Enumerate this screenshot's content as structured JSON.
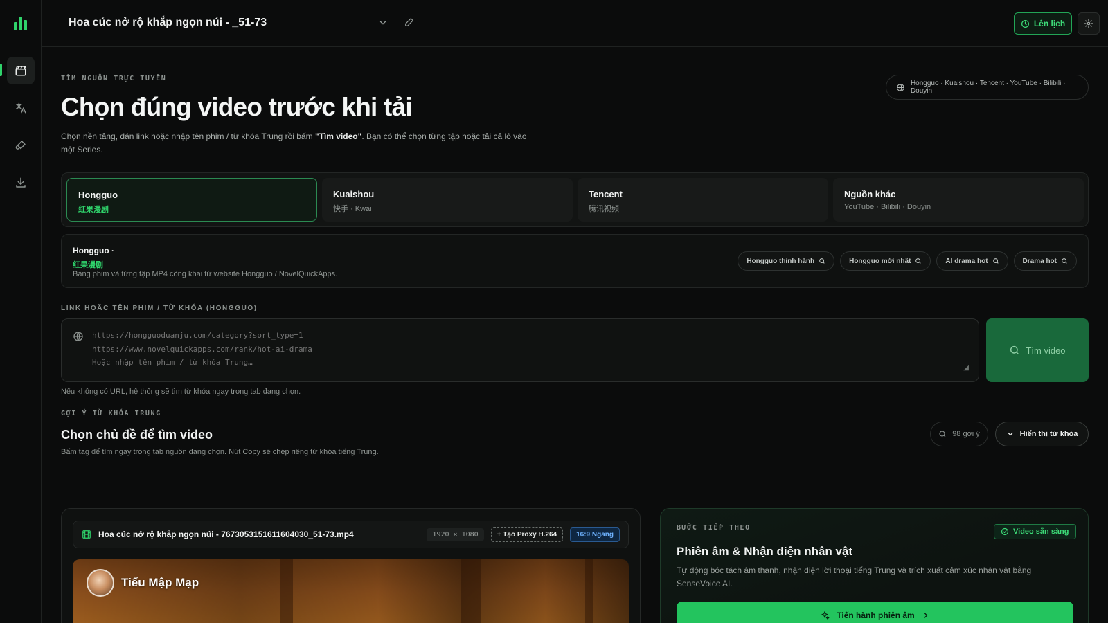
{
  "app": {
    "accent": "#2fd36b"
  },
  "sidebar": {
    "items": [
      {
        "icon": "clapperboard-icon",
        "active": true
      },
      {
        "icon": "translate-icon",
        "active": false
      },
      {
        "icon": "brush-icon",
        "active": false
      },
      {
        "icon": "download-icon",
        "active": false
      }
    ]
  },
  "header": {
    "project_title": "Hoa cúc nở rộ khắp ngọn núi - _51-73",
    "schedule_label": "Lên lịch"
  },
  "hero": {
    "eyebrow": "TÌM NGUỒN TRỰC TUYẾN",
    "title": "Chọn đúng video trước khi tải",
    "desc_before": "Chọn nền tảng, dán link hoặc nhập tên phim / từ khóa Trung rồi bấm ",
    "desc_bold": "\"Tìm video\"",
    "desc_after": ". Bạn có thể chọn từng tập hoặc tải cả lô vào một Series.",
    "sources": "Hongguo · Kuaishou · Tencent · YouTube · Bilibili · Douyin"
  },
  "platform_tabs": [
    {
      "name": "Hongguo",
      "sub": "红果漫剧",
      "active": true
    },
    {
      "name": "Kuaishou",
      "sub": "快手 · Kwai",
      "active": false
    },
    {
      "name": "Tencent",
      "sub": "腾讯视频",
      "active": false
    },
    {
      "name": "Nguồn khác",
      "sub": "YouTube · Bilibili · Douyin",
      "active": false
    }
  ],
  "platform_info": {
    "title": "Hongguo ·",
    "cn": "红果漫剧",
    "desc": "Bảng phim và từng tập MP4 công khai từ website Hongguo / NovelQuickApps.",
    "chips": [
      "Hongguo thịnh hành",
      "Hongguo mới nhất",
      "AI drama hot",
      "Drama hot"
    ]
  },
  "search": {
    "label": "LINK HOẶC TÊN PHIM / TỪ KHÓA (HONGGUO)",
    "placeholder": "https://hongguoduanju.com/category?sort_type=1\nhttps://www.novelquickapps.com/rank/hot-ai-drama\nHoặc nhập tên phim / từ khóa Trung…",
    "button_label": "Tìm video",
    "hint": "Nếu không có URL, hệ thống sẽ tìm từ khóa ngay trong tab đang chọn."
  },
  "keywords": {
    "eyebrow": "GỢI Ý TỪ KHÓA TRUNG",
    "title": "Chọn chủ đề để tìm video",
    "desc": "Bấm tag để tìm ngay trong tab nguồn đang chọn. Nút Copy sẽ chép riêng từ khóa tiếng Trung.",
    "count_label": "98 gợi ý",
    "toggle_label": "Hiển thị từ khóa"
  },
  "video": {
    "file_name": "Hoa cúc nở rộ khắp ngọn núi - 7673053151611604030_51-73.mp4",
    "resolution": "1920 × 1080",
    "proxy_label": "+ Tạo Proxy H.264",
    "ratio_label": "16:9 Ngang",
    "channel_name": "Tiểu Mập Mạp"
  },
  "next_step": {
    "eyebrow": "BƯỚC TIẾP THEO",
    "badge": "Video sẵn sàng",
    "title": "Phiên âm & Nhận diện nhân vật",
    "desc": "Tự động bóc tách âm thanh, nhận diện lời thoại tiếng Trung và trích xuất cảm xúc nhân vật bằng SenseVoice AI.",
    "button_label": "Tiến hành phiên âm"
  }
}
